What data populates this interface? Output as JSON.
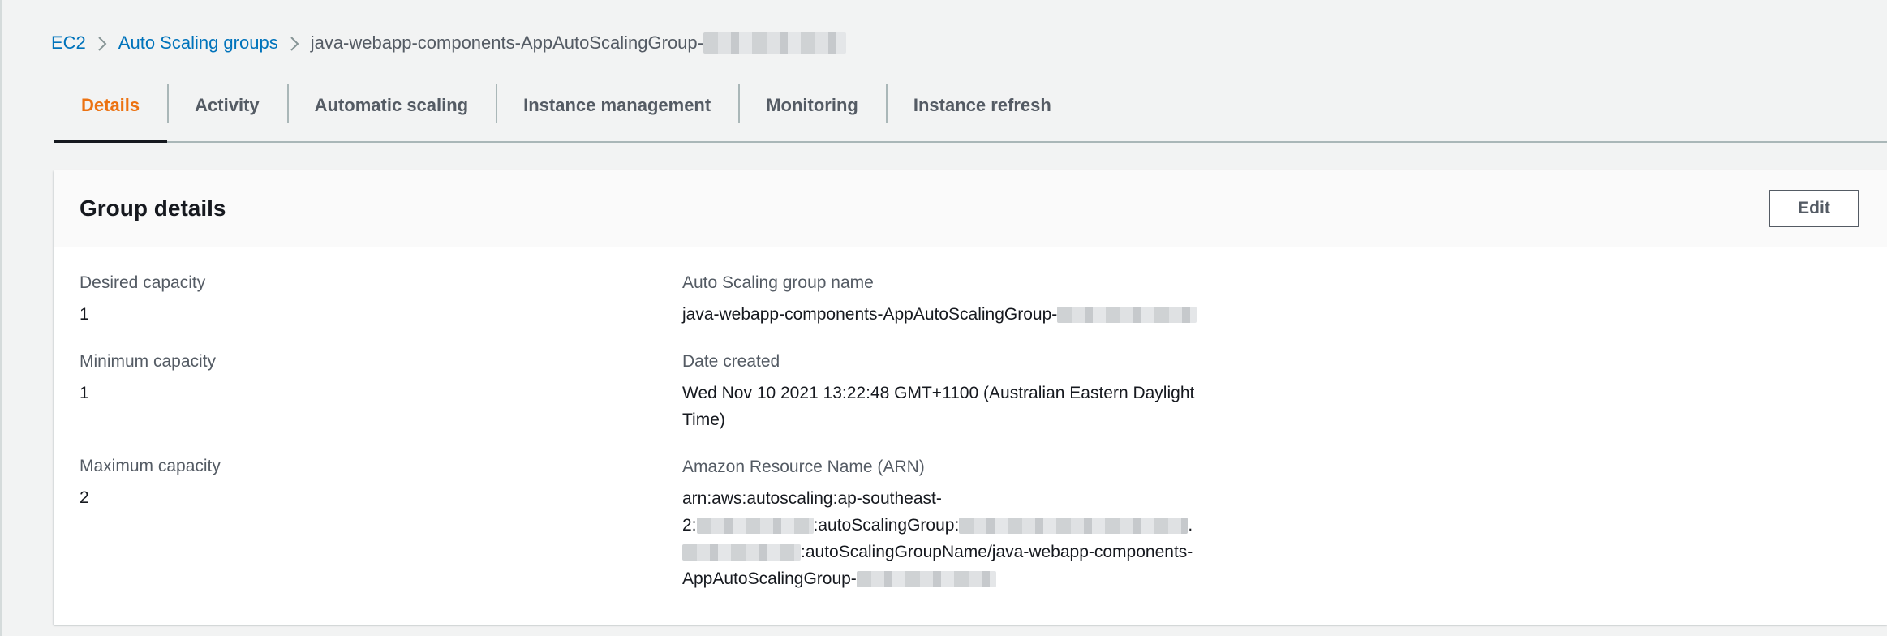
{
  "breadcrumb": {
    "items": [
      "EC2",
      "Auto Scaling groups"
    ],
    "current": "java-webapp-components-AppAutoScalingGroup-"
  },
  "tabs": [
    {
      "label": "Details",
      "active": true
    },
    {
      "label": "Activity",
      "active": false
    },
    {
      "label": "Automatic scaling",
      "active": false
    },
    {
      "label": "Instance management",
      "active": false
    },
    {
      "label": "Monitoring",
      "active": false
    },
    {
      "label": "Instance refresh",
      "active": false
    }
  ],
  "panel": {
    "title": "Group details",
    "edit_label": "Edit",
    "col1": [
      {
        "label": "Desired capacity",
        "value": "1"
      },
      {
        "label": "Minimum capacity",
        "value": "1"
      },
      {
        "label": "Maximum capacity",
        "value": "2"
      }
    ],
    "col2": {
      "group_name_label": "Auto Scaling group name",
      "group_name_value": "java-webapp-components-AppAutoScalingGroup-",
      "date_label": "Date created",
      "date_value": "Wed Nov 10 2021 13:22:48 GMT+1100 (Australian Eastern Daylight Time)",
      "arn_label": "Amazon Resource Name (ARN)",
      "arn_parts": {
        "p1": "arn:aws:autoscaling:ap-southeast-",
        "p2": "2:",
        "p3": ":autoScalingGroup:",
        "p4": ".",
        "p5": ":autoScalingGroupName/java-webapp-components-",
        "p6": "AppAutoScalingGroup-"
      }
    }
  },
  "colors": {
    "link": "#0073bb",
    "active_tab": "#ec7211",
    "text": "#16191f",
    "muted": "#545b64",
    "background": "#f2f3f3"
  }
}
